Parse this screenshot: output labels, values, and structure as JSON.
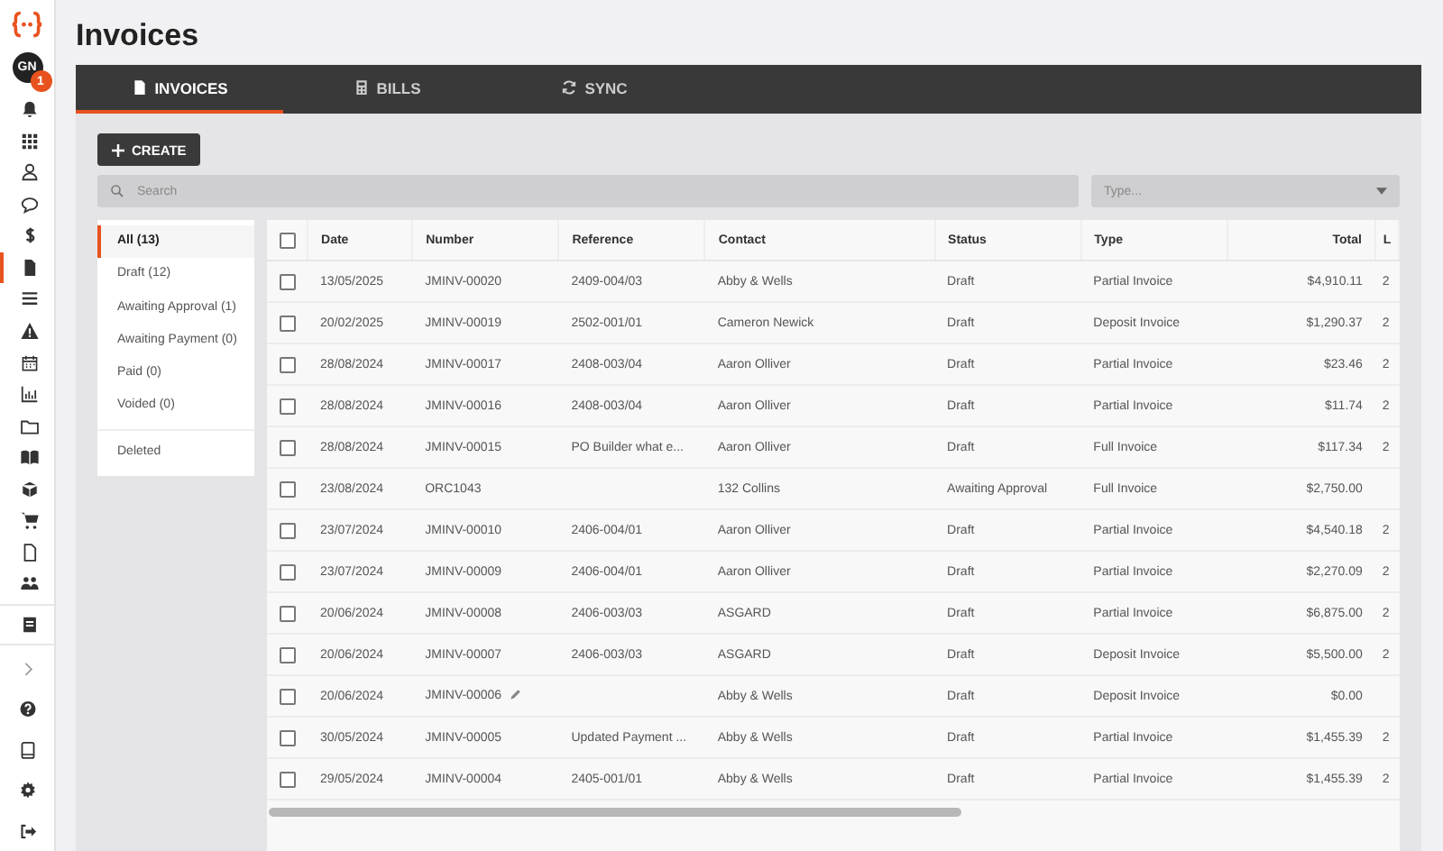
{
  "sidebar": {
    "avatar": "GN",
    "badge": "1",
    "items": [
      {
        "selected": false
      },
      {
        "selected": false
      },
      {
        "selected": false
      },
      {
        "selected": false
      },
      {
        "selected": false
      },
      {
        "selected": true
      },
      {
        "selected": false
      },
      {
        "selected": false
      },
      {
        "selected": false
      },
      {
        "selected": false
      },
      {
        "selected": false
      },
      {
        "selected": false
      },
      {
        "selected": false
      },
      {
        "selected": false
      },
      {
        "selected": false
      },
      {
        "selected": false
      },
      {
        "selected": false
      }
    ]
  },
  "page_title": "Invoices",
  "tabs": [
    {
      "label": "INVOICES",
      "selected": true
    },
    {
      "label": "BILLS",
      "selected": false
    },
    {
      "label": "SYNC",
      "selected": false
    }
  ],
  "create_button": "CREATE",
  "search": {
    "placeholder": "Search"
  },
  "type_select": {
    "placeholder": "Type..."
  },
  "filters": [
    {
      "label": "All (13)",
      "selected": true
    },
    {
      "label": "Draft (12)",
      "selected": false
    },
    {
      "label": "Awaiting Approval (1)",
      "selected": false
    },
    {
      "label": "Awaiting Payment (0)",
      "selected": false
    },
    {
      "label": "Paid (0)",
      "selected": false
    },
    {
      "label": "Voided (0)",
      "selected": false
    }
  ],
  "deleted_filter": {
    "label": "Deleted",
    "selected": false
  },
  "table": {
    "select_all_checked": false,
    "columns": [
      "Date",
      "Number",
      "Reference",
      "Contact",
      "Status",
      "Type",
      "Total",
      "L"
    ],
    "rows": [
      {
        "checked": false,
        "editable": false,
        "cells": [
          "13/05/2025",
          "JMINV-00020",
          "2409-004/03",
          "Abby & Wells",
          "Draft",
          "Partial Invoice",
          "$4,910.11",
          "2"
        ]
      },
      {
        "checked": false,
        "editable": false,
        "cells": [
          "20/02/2025",
          "JMINV-00019",
          "2502-001/01",
          "Cameron Newick",
          "Draft",
          "Deposit Invoice",
          "$1,290.37",
          "2"
        ]
      },
      {
        "checked": false,
        "editable": false,
        "cells": [
          "28/08/2024",
          "JMINV-00017",
          "2408-003/04",
          "Aaron Olliver",
          "Draft",
          "Partial Invoice",
          "$23.46",
          "2"
        ]
      },
      {
        "checked": false,
        "editable": false,
        "cells": [
          "28/08/2024",
          "JMINV-00016",
          "2408-003/04",
          "Aaron Olliver",
          "Draft",
          "Partial Invoice",
          "$11.74",
          "2"
        ]
      },
      {
        "checked": false,
        "editable": false,
        "cells": [
          "28/08/2024",
          "JMINV-00015",
          "PO Builder what e...",
          "Aaron Olliver",
          "Draft",
          "Full Invoice",
          "$117.34",
          "2"
        ]
      },
      {
        "checked": false,
        "editable": false,
        "cells": [
          "23/08/2024",
          "ORC1043",
          null,
          "132 Collins",
          "Awaiting Approval",
          "Full Invoice",
          "$2,750.00",
          null
        ]
      },
      {
        "checked": false,
        "editable": false,
        "cells": [
          "23/07/2024",
          "JMINV-00010",
          "2406-004/01",
          "Aaron Olliver",
          "Draft",
          "Partial Invoice",
          "$4,540.18",
          "2"
        ]
      },
      {
        "checked": false,
        "editable": false,
        "cells": [
          "23/07/2024",
          "JMINV-00009",
          "2406-004/01",
          "Aaron Olliver",
          "Draft",
          "Partial Invoice",
          "$2,270.09",
          "2"
        ]
      },
      {
        "checked": false,
        "editable": false,
        "cells": [
          "20/06/2024",
          "JMINV-00008",
          "2406-003/03",
          "ASGARD",
          "Draft",
          "Partial Invoice",
          "$6,875.00",
          "2"
        ]
      },
      {
        "checked": false,
        "editable": false,
        "cells": [
          "20/06/2024",
          "JMINV-00007",
          "2406-003/03",
          "ASGARD",
          "Draft",
          "Deposit Invoice",
          "$5,500.00",
          "2"
        ]
      },
      {
        "checked": false,
        "editable": true,
        "cells": [
          "20/06/2024",
          "JMINV-00006",
          null,
          "Abby & Wells",
          "Draft",
          "Deposit Invoice",
          "$0.00",
          null
        ]
      },
      {
        "checked": false,
        "editable": false,
        "cells": [
          "30/05/2024",
          "JMINV-00005",
          "Updated Payment ...",
          "Abby & Wells",
          "Draft",
          "Partial Invoice",
          "$1,455.39",
          "2"
        ]
      },
      {
        "checked": false,
        "editable": false,
        "cells": [
          "29/05/2024",
          "JMINV-00004",
          "2405-001/01",
          "Abby & Wells",
          "Draft",
          "Partial Invoice",
          "$1,455.39",
          "2"
        ]
      }
    ]
  }
}
